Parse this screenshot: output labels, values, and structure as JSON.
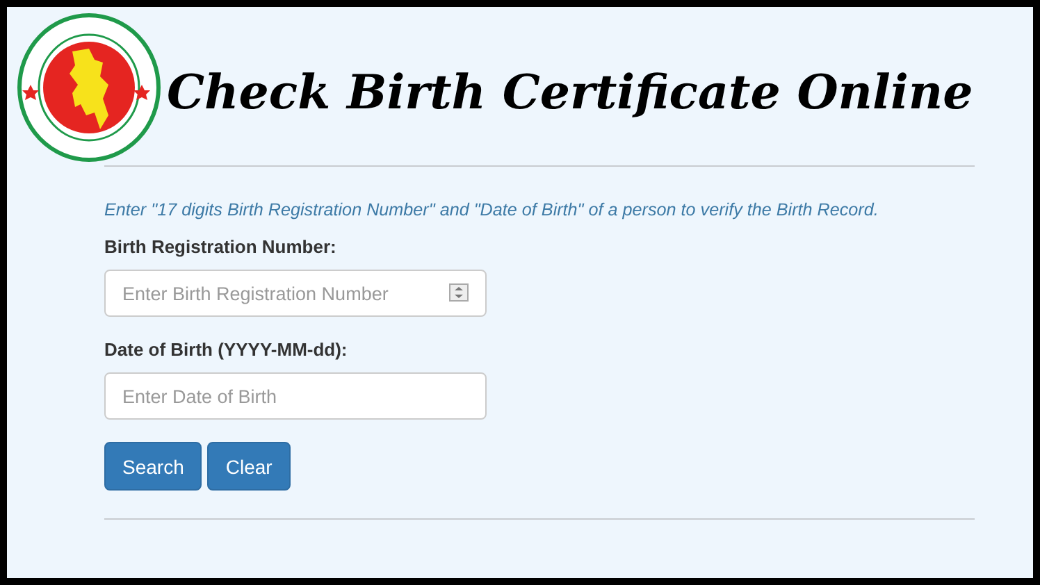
{
  "header": {
    "title": "Check Birth Certificate Online"
  },
  "instructions": "Enter \"17 digits Birth Registration Number\" and \"Date of Birth\" of a person to verify the Birth Record.",
  "fields": [
    {
      "kind": "number",
      "label": "Birth Registration Number:",
      "placeholder": "Enter Birth Registration Number"
    },
    {
      "kind": "text",
      "label": "Date of Birth (YYYY-MM-dd):",
      "placeholder": "Enter Date of Birth"
    }
  ],
  "buttons": [
    "Search",
    "Clear"
  ]
}
